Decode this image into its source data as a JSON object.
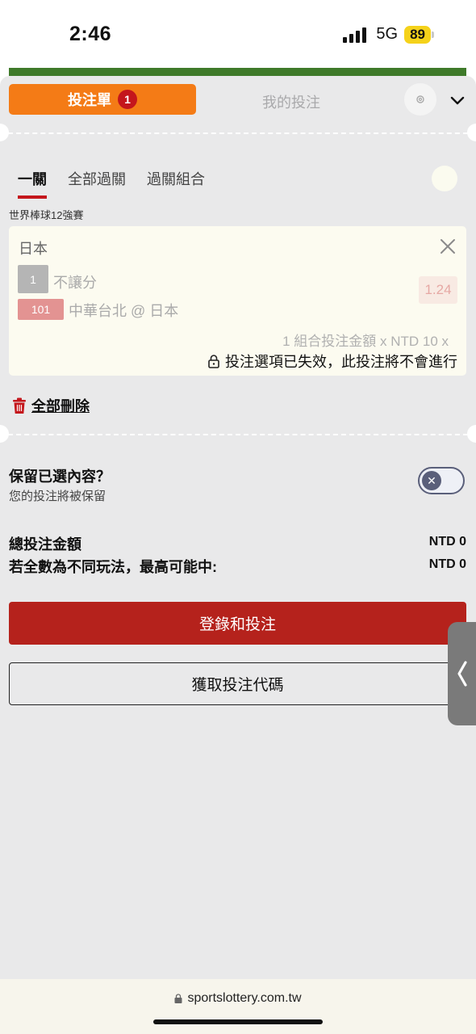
{
  "status": {
    "time": "2:46",
    "network": "5G",
    "battery": "89"
  },
  "header": {
    "active_tab": "投注單",
    "badge_count": "1",
    "inactive_tab": "我的投注"
  },
  "subtabs": [
    {
      "label": "一關"
    },
    {
      "label": "全部過關"
    },
    {
      "label": "過關組合"
    }
  ],
  "league": "世界棒球12強賽",
  "bet": {
    "team": "日本",
    "selection_code": "1",
    "selection_name": "不讓分",
    "match_code": "101",
    "match_name": "中華台北 @ 日本",
    "odds": "1.24",
    "combo_text": "1 組合投注金額 x NTD 10 x",
    "invalid_text": "投注選項已失效，此投注將不會進行"
  },
  "delete_all": "全部刪除",
  "keep": {
    "title": "保留已選內容？",
    "subtitle": "您的投注將被保留"
  },
  "totals": {
    "total_label": "總投注金額",
    "total_value": "NTD 0",
    "max_label": "若全數為不同玩法，最高可能中:",
    "max_value": "NTD 0"
  },
  "buttons": {
    "login_bet": "登錄和投注",
    "get_code": "獲取投注代碼"
  },
  "browser": {
    "url": "sportslottery.com.tw"
  },
  "colors": {
    "accent_orange": "#f47b16",
    "brand_red": "#b5221c",
    "badge_red": "#c4161c"
  },
  "icons": [
    "settings-icon",
    "chevron-down-icon",
    "close-icon",
    "lock-icon",
    "trash-icon",
    "chevron-left-icon"
  ]
}
